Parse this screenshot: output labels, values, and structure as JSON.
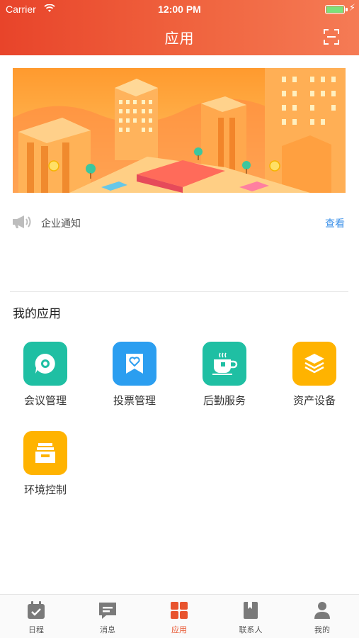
{
  "status_bar": {
    "carrier": "Carrier",
    "time": "12:00 PM"
  },
  "header": {
    "title": "应用",
    "scan_icon": "scan-icon"
  },
  "notice": {
    "label": "企业通知",
    "link": "查看",
    "icon": "megaphone-icon"
  },
  "my_apps": {
    "title": "我的应用",
    "items": [
      {
        "label": "会议管理",
        "icon": "chat-bubble-icon",
        "color": "#1fbfa3"
      },
      {
        "label": "投票管理",
        "icon": "heart-badge-icon",
        "color": "#2b9ef0"
      },
      {
        "label": "后勤服务",
        "icon": "coffee-cup-icon",
        "color": "#1fbfa3"
      },
      {
        "label": "资产设备",
        "icon": "layers-icon",
        "color": "#ffb300"
      },
      {
        "label": "环境控制",
        "icon": "cabinet-icon",
        "color": "#ffb300"
      }
    ]
  },
  "tabbar": {
    "items": [
      {
        "label": "日程",
        "icon": "calendar-icon"
      },
      {
        "label": "消息",
        "icon": "message-icon"
      },
      {
        "label": "应用",
        "icon": "grid-icon",
        "active": true
      },
      {
        "label": "联系人",
        "icon": "contacts-icon"
      },
      {
        "label": "我的",
        "icon": "person-icon"
      }
    ]
  },
  "colors": {
    "header_start": "#e8442a",
    "header_end": "#f57b55",
    "active_tab": "#e8542e",
    "link": "#3a8fe8"
  }
}
